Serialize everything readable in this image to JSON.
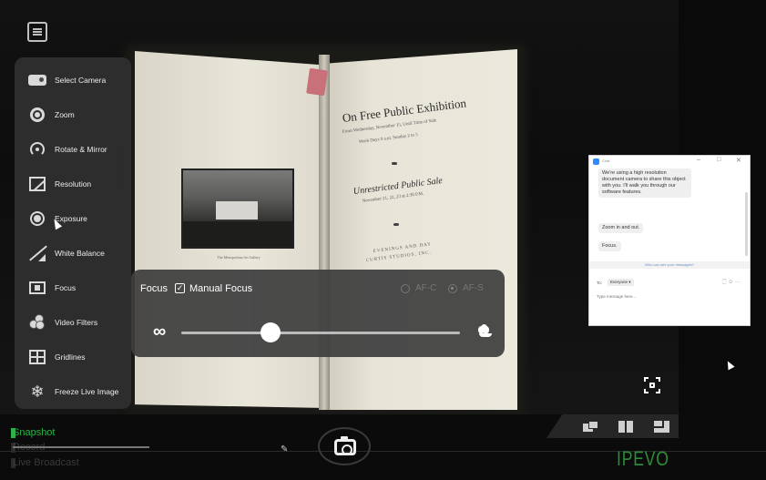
{
  "side_menu": {
    "items": [
      {
        "label": "Select Camera",
        "icon": "camera-icon"
      },
      {
        "label": "Zoom",
        "icon": "zoom-icon"
      },
      {
        "label": "Rotate & Mirror",
        "icon": "rotate-icon"
      },
      {
        "label": "Resolution",
        "icon": "resolution-icon"
      },
      {
        "label": "Exposure",
        "icon": "exposure-icon"
      },
      {
        "label": "White Balance",
        "icon": "white-balance-icon"
      },
      {
        "label": "Focus",
        "icon": "focus-icon"
      },
      {
        "label": "Video Filters",
        "icon": "video-filters-icon"
      },
      {
        "label": "Gridlines",
        "icon": "gridlines-icon"
      },
      {
        "label": "Freeze Live Image",
        "icon": "freeze-icon"
      }
    ]
  },
  "focus_panel": {
    "title": "Focus",
    "manual_label": "Manual Focus",
    "manual_checked": true,
    "checkmark": "✓",
    "afc_label": "AF-C",
    "afs_label": "AF-S",
    "selected_mode": "AF-S",
    "far_symbol": "∞",
    "slider_value": 0.32
  },
  "book": {
    "left_caption": "The Metropolitan Art Gallery",
    "title": "On Free Public Exhibition",
    "line1": "From Wednesday, November 15, Until Time of Sale",
    "line2": "Week Days 9 a.m. Sunday 2 to 5",
    "subtitle": "Unrestricted Public Sale",
    "line3": "November 21, 22, 23 at 2:30 P.M.",
    "line4": "EVENINGS AND DAY",
    "line5": "CURTIS STUDIOS, INC."
  },
  "chat": {
    "title": "Chat",
    "messages": [
      "We're using a high resolution document camera to share this object with you. I'll walk you through our software features.",
      "Zoom in and out.",
      "Focus."
    ],
    "visibility": "Who can see your messages?",
    "to_label": "To:",
    "to_value": "Everyone ▾",
    "tools": "🗋 ☺ ···",
    "input_placeholder": "Type message here..."
  },
  "bottom": {
    "modes": [
      {
        "label": "Snapshot",
        "active": true
      },
      {
        "label": "Record",
        "active": false
      },
      {
        "label": "Live Broadcast",
        "active": false
      }
    ],
    "annotate_glyph": "✎",
    "brand": "IPEVO"
  },
  "colors": {
    "accent": "#2fb04a",
    "brand": "#2e8b3a",
    "panel": "#303030"
  }
}
